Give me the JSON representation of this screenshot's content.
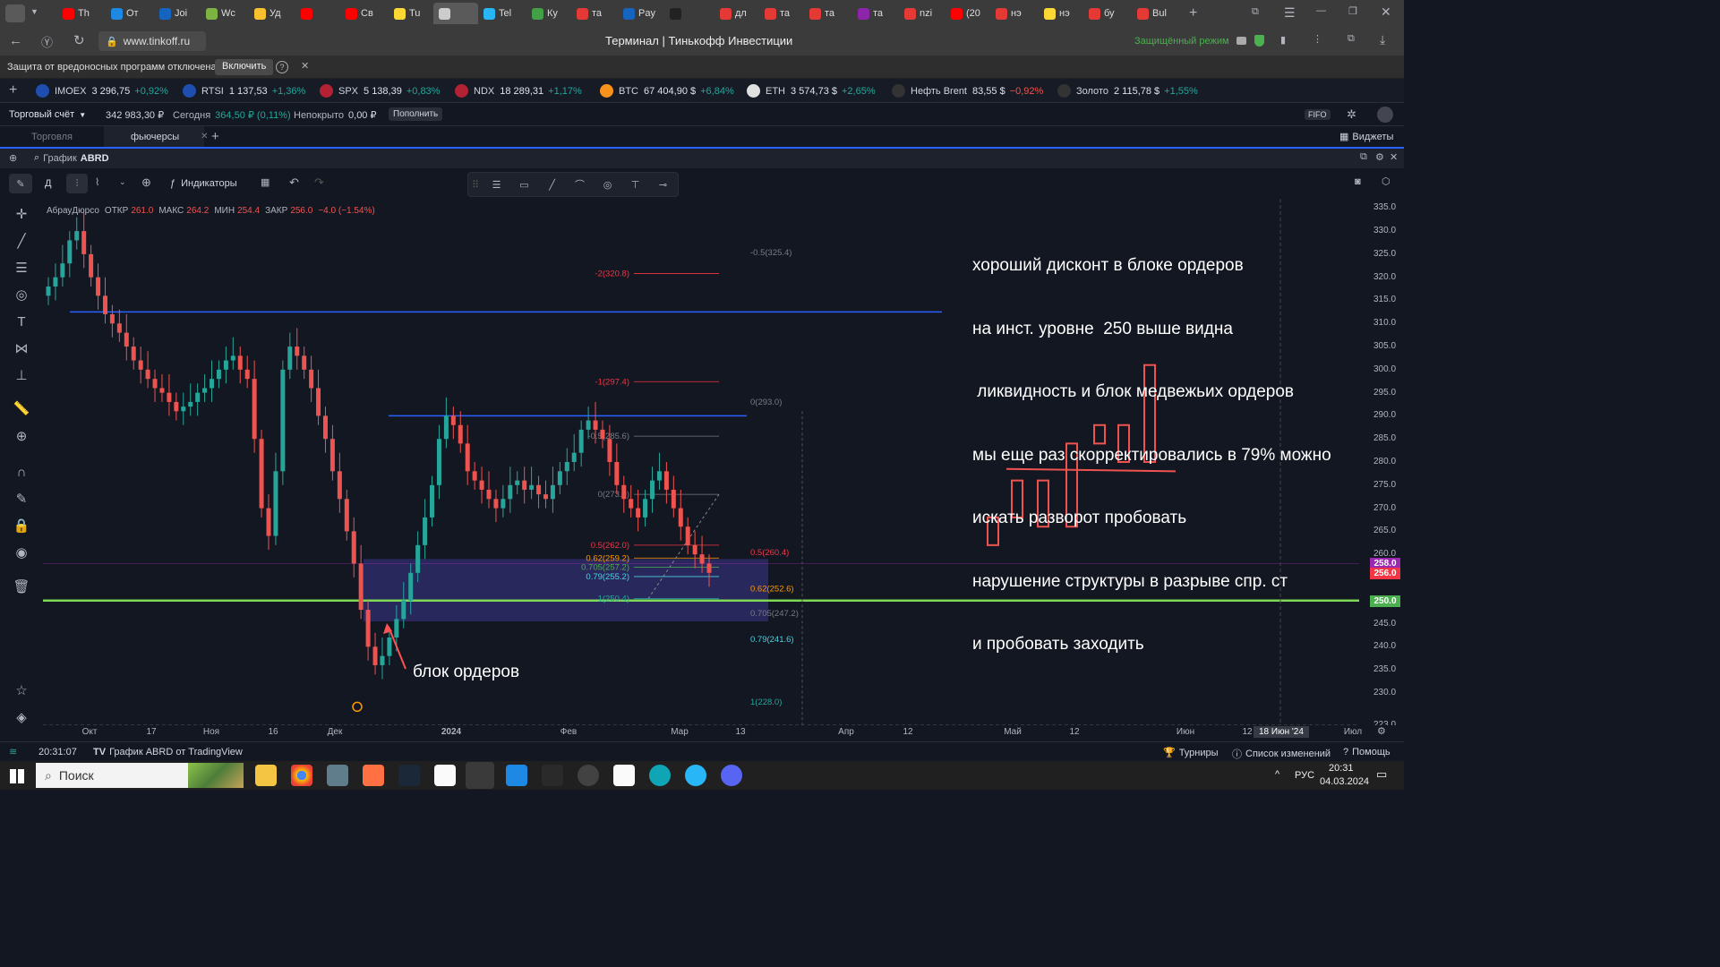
{
  "browser": {
    "tabs": [
      {
        "label": "Th",
        "color": "#ff0000"
      },
      {
        "label": "От",
        "color": "#1e88e5"
      },
      {
        "label": "Joi",
        "color": "#1565c0"
      },
      {
        "label": "Wc",
        "color": "#7cb342"
      },
      {
        "label": "Уд",
        "color": "#fbc02d"
      },
      {
        "label": "",
        "color": "#ff0000"
      },
      {
        "label": "Св",
        "color": "#ff0000"
      },
      {
        "label": "Tu",
        "color": "#fdd835"
      },
      {
        "label": "",
        "color": "#cccccc"
      },
      {
        "label": "Tel",
        "color": "#29b6f6"
      },
      {
        "label": "Ку",
        "color": "#43a047"
      },
      {
        "label": "та",
        "color": "#e53935"
      },
      {
        "label": "Pay",
        "color": "#1565c0"
      },
      {
        "label": "",
        "color": "#222222"
      },
      {
        "label": "дл",
        "color": "#e53935"
      },
      {
        "label": "та",
        "color": "#e53935"
      },
      {
        "label": "та",
        "color": "#e53935"
      },
      {
        "label": "та",
        "color": "#8e24aa"
      },
      {
        "label": "nzi",
        "color": "#e53935"
      },
      {
        "label": "(20",
        "color": "#ff0000"
      },
      {
        "label": "нэ",
        "color": "#e53935"
      },
      {
        "label": "нэ",
        "color": "#fdd835"
      },
      {
        "label": "бу",
        "color": "#e53935"
      },
      {
        "label": "Bul",
        "color": "#e53935"
      }
    ],
    "url": "www.tinkoff.ru",
    "page_title": "Терминал | Тинькофф Инвестиции",
    "protected_mode": "Защищённый режим",
    "warning": "Защита от вредоносных программ отключена",
    "enable": "Включить"
  },
  "ticker": [
    {
      "name": "IMOEX",
      "price": "3 296,75",
      "chg": "+0,92%",
      "dir": "pos",
      "flag": "#1e4fb0"
    },
    {
      "name": "RTSI",
      "price": "1 137,53",
      "chg": "+1,36%",
      "dir": "pos",
      "flag": "#1e4fb0"
    },
    {
      "name": "SPX",
      "price": "5 138,39",
      "chg": "+0,83%",
      "dir": "pos",
      "flag": "#b22234"
    },
    {
      "name": "NDX",
      "price": "18 289,31",
      "chg": "+1,17%",
      "dir": "pos",
      "flag": "#b22234"
    },
    {
      "name": "BTC",
      "price": "67 404,90 $",
      "chg": "+6,84%",
      "dir": "pos",
      "flag": "#f7931a"
    },
    {
      "name": "ETH",
      "price": "3 574,73 $",
      "chg": "+2,65%",
      "dir": "pos",
      "flag": "#e0e0e0"
    },
    {
      "name": "Нефть Brent",
      "price": "83,55 $",
      "chg": "−0,92%",
      "dir": "neg",
      "flag": "#333333"
    },
    {
      "name": "Золото",
      "price": "2 115,78 $",
      "chg": "+1,55%",
      "dir": "pos",
      "flag": "#333333"
    }
  ],
  "account": {
    "name": "Торговый счёт",
    "balance": "342 983,30 ₽",
    "today_label": "Сегодня",
    "today": "364,50 ₽ (0,11%)",
    "uncovered_label": "Непокрыто",
    "uncovered": "0,00 ₽",
    "topup": "Пополнить",
    "fifo": "FIFO"
  },
  "workspace_tabs": [
    "Торговля",
    "фьючерсы"
  ],
  "widgets": "Виджеты",
  "chart_header": {
    "label": "График",
    "symbol": "ABRD"
  },
  "toolbar": {
    "interval": "Д",
    "indicators": "Индикаторы"
  },
  "legend": {
    "name": "АбрауДюрсо",
    "o_label": "ОТКР",
    "o": "261.0",
    "h_label": "МАКС",
    "h": "264.2",
    "l_label": "МИН",
    "l": "254.4",
    "c_label": "ЗАКР",
    "c": "256.0",
    "chg": "−4.0 (−1.54%)"
  },
  "annotation": {
    "lines": [
      "хороший дисконт в блоке ордеров",
      "на инст. уровне  250 выше видна",
      " ликвидность и блок медвежьих ордеров",
      "мы еще раз скорректировались в 79% можно",
      "искать разворот пробовать",
      "нарушение структуры в разрыве спр. ст",
      "и пробовать заходить"
    ],
    "order_block": "блок ордеров"
  },
  "fib_right": [
    {
      "t": "-0.5(325.4)",
      "v": 325.4,
      "c": "#787b86"
    },
    {
      "t": "0(293.0)",
      "v": 293.0,
      "c": "#787b86"
    },
    {
      "t": "0.5(260.4)",
      "v": 260.4,
      "c": "#f23645"
    },
    {
      "t": "0.62(252.6)",
      "v": 252.6,
      "c": "#ff9800"
    },
    {
      "t": "0.705(247.2)",
      "v": 247.2,
      "c": "#787b86"
    },
    {
      "t": "0.79(241.6)",
      "v": 241.6,
      "c": "#4dd0e1"
    },
    {
      "t": "1(228.0)",
      "v": 228.0,
      "c": "#26a69a"
    }
  ],
  "fib_left": [
    {
      "t": "-2(320.8)",
      "v": 320.8,
      "c": "#f23645"
    },
    {
      "t": "-1(297.4)",
      "v": 297.4,
      "c": "#f23645"
    },
    {
      "t": "-0.5(285.6)",
      "v": 285.6,
      "c": "#787b86"
    },
    {
      "t": "0(273.0)",
      "v": 273.0,
      "c": "#787b86"
    },
    {
      "t": "0.5(262.0)",
      "v": 262.0,
      "c": "#f23645"
    },
    {
      "t": "0.62(259.2)",
      "v": 259.2,
      "c": "#ff9800"
    },
    {
      "t": "0.705(257.2)",
      "v": 257.2,
      "c": "#4caf50"
    },
    {
      "t": "0.79(255.2)",
      "v": 255.2,
      "c": "#4dd0e1"
    },
    {
      "t": "1(250.4)",
      "v": 250.4,
      "c": "#26a69a"
    }
  ],
  "y_ticks": [
    "335.0",
    "330.0",
    "325.0",
    "320.0",
    "315.0",
    "310.0",
    "305.0",
    "300.0",
    "295.0",
    "290.0",
    "285.0",
    "280.0",
    "275.0",
    "270.0",
    "265.0",
    "260.0",
    "245.0",
    "240.0",
    "235.0",
    "230.0",
    "223.0"
  ],
  "price_tags": [
    {
      "t": "258.0",
      "bg": "#9c27b0"
    },
    {
      "t": "256.0",
      "bg": "#f23645"
    },
    {
      "t": "250.0",
      "bg": "#4caf50"
    }
  ],
  "x_ticks": [
    "Окт",
    "17",
    "Ноя",
    "16",
    "Дек",
    "2024",
    "Фев",
    "Мар",
    "13",
    "Апр",
    "12",
    "Май",
    "12",
    "Июн",
    "12",
    "Июл"
  ],
  "x_cursor": "18 Июн '24",
  "levels": {
    "blue_high": 312.5,
    "blue_mid": 290.0,
    "green": 250.0
  },
  "status": {
    "time": "20:31:07",
    "tv": "График ABRD от TradingView",
    "tournaments": "Турниры",
    "changes": "Список изменений",
    "help": "Помощь"
  },
  "taskbar": {
    "search": "Поиск",
    "lang": "РУС",
    "time": "20:31",
    "date": "04.03.2024"
  },
  "chart_data": {
    "type": "candlestick",
    "symbol": "ABRD",
    "ylim": [
      223,
      337
    ],
    "ohlc_last": {
      "open": 261.0,
      "high": 264.2,
      "low": 254.4,
      "close": 256.0
    },
    "close_approx": [
      318,
      320,
      323,
      328,
      330,
      325,
      320,
      316,
      312,
      310,
      308,
      305,
      302,
      300,
      298,
      296,
      295,
      293,
      291,
      292,
      293,
      295,
      296,
      298,
      300,
      302,
      303,
      300,
      298,
      285,
      270,
      264,
      278,
      300,
      305,
      303,
      300,
      296,
      290,
      285,
      278,
      272,
      265,
      258,
      248,
      240,
      236,
      238,
      242,
      246,
      250,
      256,
      262,
      268,
      275,
      285,
      290,
      288,
      284,
      278,
      276,
      274,
      272,
      270,
      272,
      275,
      276,
      274,
      275,
      273,
      272,
      275,
      278,
      280,
      282,
      287,
      289,
      287,
      285,
      280,
      275,
      272,
      270,
      268,
      272,
      276,
      278,
      274,
      270,
      266,
      262,
      260,
      258,
      256
    ],
    "sketch_closes": [
      268,
      276,
      266,
      284,
      288,
      280,
      301
    ]
  }
}
